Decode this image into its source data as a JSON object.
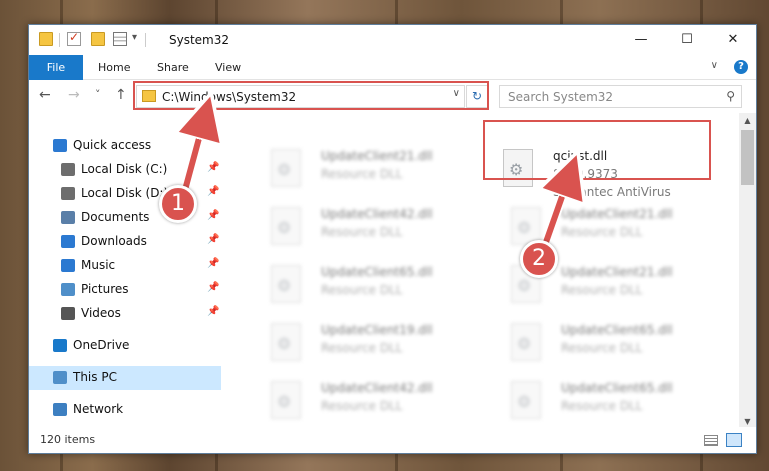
{
  "window": {
    "title": "System32",
    "minimize_glyph": "—",
    "maximize_glyph": "☐",
    "close_glyph": "✕"
  },
  "ribbon": {
    "file": "File",
    "home": "Home",
    "share": "Share",
    "view": "View",
    "expand_glyph": "∨",
    "help_glyph": "?"
  },
  "nav": {
    "back_glyph": "←",
    "forward_glyph": "→",
    "recent_glyph": "˅",
    "up_glyph": "↑",
    "address": "C:\\Windows\\System32",
    "address_dd_glyph": "∨",
    "refresh_glyph": "↻",
    "search_placeholder": "Search System32",
    "search_glyph": "⚲"
  },
  "sidebar": {
    "items": [
      {
        "label": "Quick access",
        "icon": "star-icon",
        "color": "#2b79d1",
        "pinned": false
      },
      {
        "label": "Local Disk (C:)",
        "icon": "drive-icon",
        "color": "#6d6d6d",
        "pinned": true
      },
      {
        "label": "Local Disk (D:)",
        "icon": "drive-icon",
        "color": "#6d6d6d",
        "pinned": true
      },
      {
        "label": "Documents",
        "icon": "documents-icon",
        "color": "#5a7fa8",
        "pinned": true
      },
      {
        "label": "Downloads",
        "icon": "downloads-icon",
        "color": "#2b79d1",
        "pinned": true
      },
      {
        "label": "Music",
        "icon": "music-icon",
        "color": "#2b79d1",
        "pinned": true
      },
      {
        "label": "Pictures",
        "icon": "pictures-icon",
        "color": "#4f8fc9",
        "pinned": true
      },
      {
        "label": "Videos",
        "icon": "videos-icon",
        "color": "#555555",
        "pinned": true
      },
      {
        "label": "OneDrive",
        "icon": "cloud-icon",
        "color": "#1979ca",
        "pinned": false
      },
      {
        "label": "This PC",
        "icon": "computer-icon",
        "color": "#4f8fc9",
        "pinned": false
      },
      {
        "label": "Network",
        "icon": "network-icon",
        "color": "#3d7fc1",
        "pinned": false
      }
    ],
    "pin_glyph": "📌"
  },
  "files": {
    "left": [
      {
        "name": "UpdateClient21.dll",
        "type": "Resource DLL"
      },
      {
        "name": "UpdateClient42.dll",
        "type": "Resource DLL"
      },
      {
        "name": "UpdateClient65.dll",
        "type": "Resource DLL"
      },
      {
        "name": "UpdateClient19.dll",
        "type": "Resource DLL"
      },
      {
        "name": "UpdateClient42.dll",
        "type": "Resource DLL"
      }
    ],
    "highlighted": {
      "name": "qcinst.dll",
      "version": "8.0.0.9373",
      "company": "Symantec AntiVirus"
    },
    "right": [
      {
        "name": "UpdateClient21.dll",
        "type": "Resource DLL"
      },
      {
        "name": "UpdateClient21.dll",
        "type": "Resource DLL"
      },
      {
        "name": "UpdateClient65.dll",
        "type": "Resource DLL"
      },
      {
        "name": "UpdateClient65.dll",
        "type": "Resource DLL"
      }
    ]
  },
  "status": {
    "item_count": "120 items"
  },
  "annotations": {
    "step1": "1",
    "step2": "2",
    "color": "#d9534f"
  }
}
